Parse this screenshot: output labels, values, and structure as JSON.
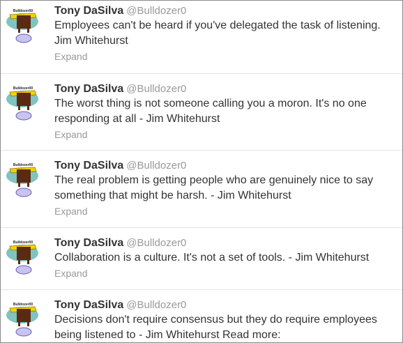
{
  "tweets": [
    {
      "name": "Tony DaSilva",
      "handle": "@Bulldozer0",
      "text": "Employees can't be heard if you've delegated the task of listening. Jim Whitehurst",
      "expand": "Expand",
      "avatar_label": "Bulldozer00"
    },
    {
      "name": "Tony DaSilva",
      "handle": "@Bulldozer0",
      "text": "The worst thing is not someone calling you a moron. It's no one responding at all - Jim Whitehurst",
      "expand": "Expand",
      "avatar_label": "Bulldozer00"
    },
    {
      "name": "Tony DaSilva",
      "handle": "@Bulldozer0",
      "text": "The real problem is getting people who are genuinely nice to say something that might be harsh. - Jim Whitehurst",
      "expand": "Expand",
      "avatar_label": "Bulldozer00"
    },
    {
      "name": "Tony DaSilva",
      "handle": "@Bulldozer0",
      "text": "Collaboration is a culture. It's not a set of tools. - Jim Whitehurst",
      "expand": "Expand",
      "avatar_label": "Bulldozer00"
    },
    {
      "name": "Tony DaSilva",
      "handle": "@Bulldozer0",
      "text": "Decisions don't require consensus but they do require employees being listened to - Jim Whitehurst Read more:",
      "expand": "",
      "avatar_label": "Bulldozer00"
    }
  ],
  "colors": {
    "name": "#333333",
    "handle": "#999999",
    "text": "#333333",
    "divider": "#e3e3e3",
    "avatar_teal": "#7fc4c0",
    "avatar_yellow": "#f2d200",
    "avatar_brown": "#5a2a12",
    "avatar_badge": "#c9c3ef"
  },
  "icons": [
    "bulldozer-avatar-icon"
  ]
}
